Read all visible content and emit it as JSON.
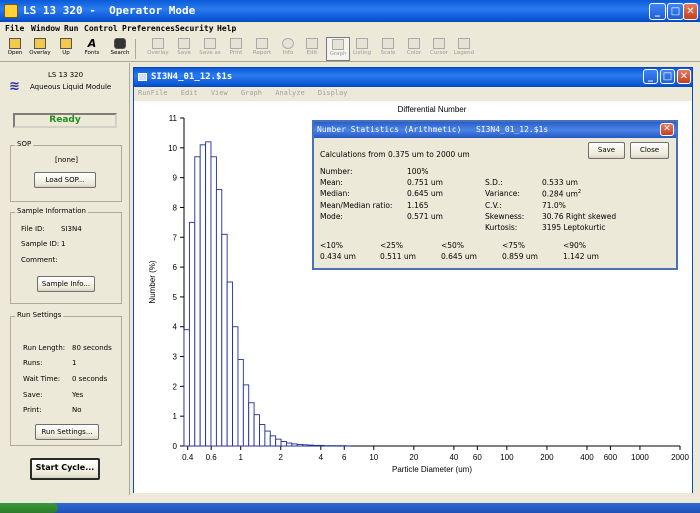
{
  "app": {
    "title": "LS 13 320 -  Operator Mode",
    "menus": [
      "File",
      "Window",
      "Run",
      "Control",
      "Preferences",
      "Security",
      "Help"
    ]
  },
  "toolbar": {
    "buttons": [
      {
        "label": "Open",
        "icon": "folder-open-icon",
        "enabled": true
      },
      {
        "label": "Overlay",
        "icon": "overlay-folder-icon",
        "enabled": true
      },
      {
        "label": "Up",
        "icon": "up-folder-icon",
        "enabled": true
      },
      {
        "label": "Fonts",
        "icon": "font-a-icon",
        "enabled": true
      },
      {
        "label": "Search",
        "icon": "binoculars-icon",
        "enabled": true
      },
      {
        "label": "Overlay",
        "icon": "overlay-icon",
        "enabled": false
      },
      {
        "label": "Save",
        "icon": "save-icon",
        "enabled": false
      },
      {
        "label": "Save as",
        "icon": "save-as-icon",
        "enabled": false
      },
      {
        "label": "Print",
        "icon": "print-icon",
        "enabled": false
      },
      {
        "label": "Report",
        "icon": "report-icon",
        "enabled": false
      },
      {
        "label": "Info",
        "icon": "info-icon",
        "enabled": false
      },
      {
        "label": "Edit",
        "icon": "edit-icon",
        "enabled": false
      },
      {
        "label": "Graph",
        "icon": "graph-icon",
        "enabled": false
      },
      {
        "label": "Listing",
        "icon": "listing-icon",
        "enabled": false
      },
      {
        "label": "Scale",
        "icon": "scale-icon",
        "enabled": false
      },
      {
        "label": "Color",
        "icon": "color-icon",
        "enabled": false
      },
      {
        "label": "Cursor",
        "icon": "cursor-icon",
        "enabled": false
      },
      {
        "label": "Legend",
        "icon": "legend-icon",
        "enabled": false
      }
    ]
  },
  "left_panel": {
    "model": "LS 13 320",
    "module": "Aqueous Liquid Module",
    "status": "Ready",
    "sop": {
      "title": "SOP",
      "value": "[none]",
      "button": "Load SOP..."
    },
    "sample": {
      "title": "Sample Information",
      "file_id_label": "File ID:",
      "file_id": "SI3N4",
      "sample_id_label": "Sample ID:",
      "sample_id": "1",
      "comment_label": "Comment:",
      "button": "Sample Info..."
    },
    "run": {
      "title": "Run Settings",
      "run_length_label": "Run Length:",
      "run_length": "80 seconds",
      "runs_label": "Runs:",
      "runs": "1",
      "wait_time_label": "Wait Time:",
      "wait_time": "0 seconds",
      "save_label": "Save:",
      "save": "Yes",
      "print_label": "Print:",
      "print": "No",
      "button": "Run Settings..."
    },
    "start_button": "Start Cycle..."
  },
  "doc_window": {
    "title": "SI3N4_01_12.$1s",
    "menus": [
      "RunFile",
      "Edit",
      "View",
      "Graph",
      "Analyze",
      "Display"
    ]
  },
  "chart_data": {
    "type": "bar",
    "title": "Differential Number",
    "xlabel": "Particle Diameter (um)",
    "ylabel": "Number (%)",
    "x_scale": "log",
    "xlim": [
      0.375,
      2000
    ],
    "ylim": [
      0,
      11
    ],
    "x_ticks": [
      0.4,
      0.6,
      1,
      2,
      4,
      6,
      10,
      20,
      40,
      60,
      100,
      200,
      400,
      600,
      1000,
      2000
    ],
    "y_ticks": [
      0,
      1,
      2,
      3,
      4,
      5,
      6,
      7,
      8,
      9,
      10,
      11
    ],
    "bin_edges": [
      0.375,
      0.412,
      0.452,
      0.496,
      0.545,
      0.598,
      0.657,
      0.721,
      0.791,
      0.869,
      0.954,
      1.047,
      1.149,
      1.261,
      1.385,
      1.52,
      1.668,
      1.832,
      2.011,
      2.207,
      2.423,
      2.66,
      2.92,
      3.206,
      3.519,
      3.862,
      4.241,
      4.656,
      5.111,
      5.611,
      6.16,
      6.761
    ],
    "values": [
      3.9,
      7.5,
      9.7,
      10.1,
      10.2,
      9.7,
      8.6,
      7.1,
      5.5,
      4.0,
      2.9,
      2.05,
      1.45,
      1.05,
      0.72,
      0.5,
      0.34,
      0.23,
      0.15,
      0.1,
      0.07,
      0.05,
      0.04,
      0.03,
      0.02,
      0.02,
      0.01,
      0.01,
      0.01,
      0.01,
      0.005
    ],
    "grid": false,
    "legend": "none"
  },
  "stats_dialog": {
    "title": "Number Statistics (Arithmetic)   SI3N4_01_12.$1s",
    "range": "Calculations from 0.375 um to 2000 um",
    "save_button": "Save",
    "close_button": "Close",
    "left_rows": [
      {
        "label": "Number:",
        "value": "100%"
      },
      {
        "label": "Mean:",
        "value": "0.751 um"
      },
      {
        "label": "Median:",
        "value": "0.645 um"
      },
      {
        "label": "Mean/Median ratio:",
        "value": "1.165"
      },
      {
        "label": "Mode:",
        "value": "0.571 um"
      }
    ],
    "right_rows": [
      {
        "label": "S.D.:",
        "value": "0.533 um"
      },
      {
        "label": "Variance:",
        "value": "0.284 um",
        "sup": "2"
      },
      {
        "label": "C.V.:",
        "value": "71.0%"
      },
      {
        "label": "Skewness:",
        "value": "30.76 Right skewed"
      },
      {
        "label": "Kurtosis:",
        "value": "3195 Leptokurtic"
      }
    ],
    "percentiles": [
      {
        "label": "<10%",
        "value": "0.434 um"
      },
      {
        "label": "<25%",
        "value": "0.511 um"
      },
      {
        "label": "<50%",
        "value": "0.645 um"
      },
      {
        "label": "<75%",
        "value": "0.859 um"
      },
      {
        "label": "<90%",
        "value": "1.142 um"
      }
    ]
  }
}
